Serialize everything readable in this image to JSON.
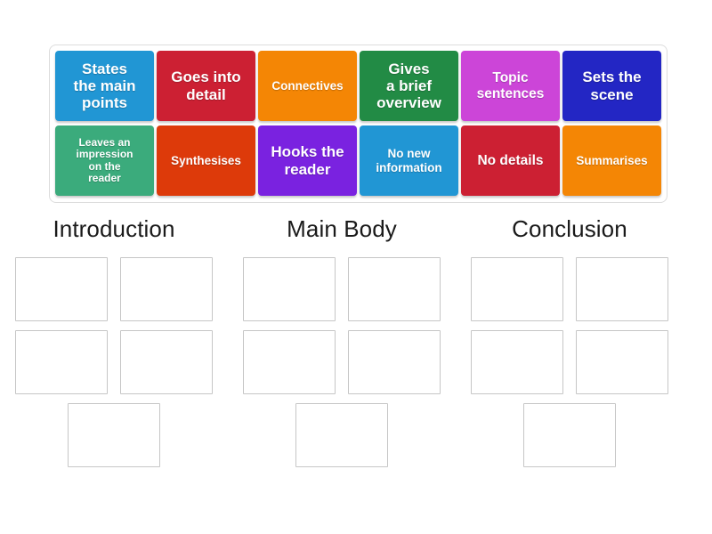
{
  "tile_bank": {
    "rows": [
      [
        {
          "label": "States\nthe main\npoints",
          "color": "#2196d4",
          "size": "sz-lg"
        },
        {
          "label": "Goes into\ndetail",
          "color": "#cc2033",
          "size": "sz-lg"
        },
        {
          "label": "Connectives",
          "color": "#f48605",
          "size": "sz-sm"
        },
        {
          "label": "Gives\na brief\noverview",
          "color": "#228b45",
          "size": "sz-lg"
        },
        {
          "label": "Topic\nsentences",
          "color": "#cc45d8",
          "size": "sz-md"
        },
        {
          "label": "Sets the\nscene",
          "color": "#2326c4",
          "size": "sz-lg"
        }
      ],
      [
        {
          "label": "Leaves an\nimpression\non the\nreader",
          "color": "#3bab7c",
          "size": "sz-xs"
        },
        {
          "label": "Synthesises",
          "color": "#dd3a0a",
          "size": "sz-sm"
        },
        {
          "label": "Hooks the\nreader",
          "color": "#7a22e0",
          "size": "sz-lg"
        },
        {
          "label": "No new\ninformation",
          "color": "#2196d4",
          "size": "sz-sm"
        },
        {
          "label": "No details",
          "color": "#cc2033",
          "size": "sz-md"
        },
        {
          "label": "Summarises",
          "color": "#f48605",
          "size": "sz-sm"
        }
      ]
    ]
  },
  "columns": [
    {
      "title": "Introduction",
      "slots": 5
    },
    {
      "title": "Main Body",
      "slots": 5
    },
    {
      "title": "Conclusion",
      "slots": 5
    }
  ],
  "colors": {
    "panel_border": "#dcdcdc",
    "slot_border": "#c6c6c6",
    "background": "#ffffff",
    "title_text": "#1a1a1a"
  }
}
